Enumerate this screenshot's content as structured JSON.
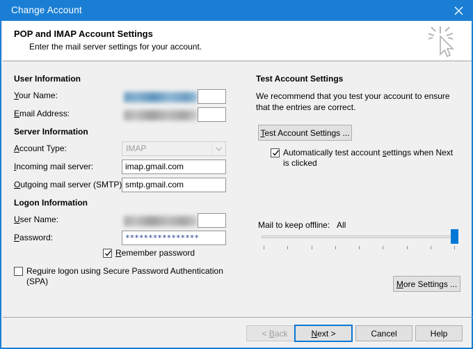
{
  "window": {
    "title": "Change Account",
    "close_icon": "close-icon"
  },
  "banner": {
    "title": "POP and IMAP Account Settings",
    "subtitle": "Enter the mail server settings for your account.",
    "icon": "cursor-click-icon"
  },
  "user_information": {
    "section_label": "User Information",
    "your_name": {
      "label": "Your Name:",
      "value": "",
      "redacted": true
    },
    "email_address": {
      "label": "Email Address:",
      "value": "",
      "redacted": true
    }
  },
  "server_information": {
    "section_label": "Server Information",
    "account_type": {
      "label": "Account Type:",
      "value": "IMAP",
      "disabled": true
    },
    "incoming_mail_server": {
      "label": "Incoming mail server:",
      "value": "imap.gmail.com"
    },
    "outgoing_mail_server": {
      "label": "Outgoing mail server (SMTP):",
      "value": "smtp.gmail.com"
    }
  },
  "logon_information": {
    "section_label": "Logon Information",
    "user_name": {
      "label": "User Name:",
      "value": "",
      "redacted": true
    },
    "password": {
      "label": "Password:",
      "value": "****************"
    },
    "remember_password": {
      "label": "Remember password",
      "checked": true
    },
    "require_spa": {
      "label": "Require logon using Secure Password Authentication (SPA)",
      "checked": false
    }
  },
  "test_account": {
    "section_label": "Test Account Settings",
    "description": "We recommend that you test your account to ensure that the entries are correct.",
    "test_button": "Test Account Settings ...",
    "auto_test": {
      "label": "Automatically test account settings when Next is clicked",
      "checked": true
    }
  },
  "offline": {
    "label": "Mail to keep offline:",
    "value": "All",
    "slider_percent": 100,
    "tick_count": 9
  },
  "more_settings_button": "More Settings ...",
  "footer": {
    "back": "< Back",
    "next": "Next >",
    "cancel": "Cancel",
    "help": "Help"
  },
  "colors": {
    "title_bar": "#1a7fd4",
    "accent": "#0078d7",
    "dialog_bg": "#f0f0f0"
  }
}
